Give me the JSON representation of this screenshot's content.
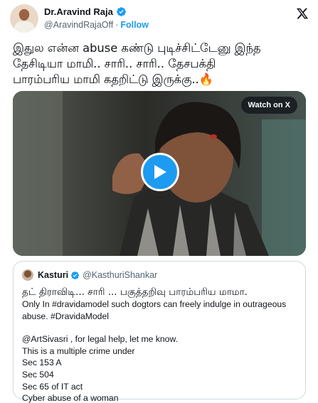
{
  "author": {
    "display_name": "Dr.Aravind Raja",
    "handle": "@AravindRajaOff",
    "separator": "·",
    "follow_label": "Follow"
  },
  "brand": {
    "accent": "#1d9bf0",
    "icon": "x-logo-icon"
  },
  "tweet": {
    "text_line1": "இதுல என்ன abuse கண்டு புடிச்சிட்டேனு இந்த",
    "text_line2": "தேசிடியா மாமி.. சாரி.. சாரி.. தேசபக்தி",
    "text_line3": "பாரம்பரிய மாமி கதறிட்டு இருக்கு..🔥"
  },
  "media": {
    "watch_label": "Watch on X",
    "play_icon": "play-icon"
  },
  "quote": {
    "display_name": "Kasturi",
    "handle": "@KasthuriShankar",
    "line1": "தட் திராவிடி... சாரி ... பகுத்தறிவு பாரம்பரிய மாமா.",
    "line2": "Only In #dravidamodel such dogtors can freely indulge in outrageous",
    "line3": "abuse. #DravidaModel",
    "line4": "@ArtSivasri , for legal help, let me know.",
    "line5": "This is a multiple crime under",
    "line6": "Sec 153 A",
    "line7": "Sec 504",
    "line8": "Sec 65 of IT act",
    "line9": "Cyber abuse of a woman"
  }
}
